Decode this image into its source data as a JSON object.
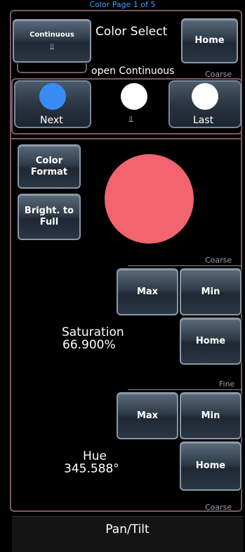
{
  "header": {
    "page_indicator": "Color Page 1 of 5"
  },
  "top": {
    "continuous_label": "Continuous",
    "title": "Color Select",
    "home_label": "Home",
    "open_continuous": "open Continuous",
    "coarse_label": "Coarse"
  },
  "palette": {
    "next_label": "Next",
    "last_label": "Last",
    "next_color": "#3a8cf5",
    "middle_color": "#ffffff",
    "last_color": "#ffffff"
  },
  "controls": {
    "color_format_label": "Color Format",
    "bright_full_label": "Bright. to Full",
    "current_color": "#f2646f"
  },
  "saturation": {
    "section_label": "Coarse",
    "max_label": "Max",
    "min_label": "Min",
    "home_label": "Home",
    "name": "Saturation",
    "value": "66.900%"
  },
  "hue": {
    "section_label": "Fine",
    "max_label": "Max",
    "min_label": "Min",
    "home_label": "Home",
    "name": "Hue",
    "value": "345.588°"
  },
  "footer_section_label": "Coarse",
  "bottom": {
    "label": "Pan/Tilt"
  }
}
